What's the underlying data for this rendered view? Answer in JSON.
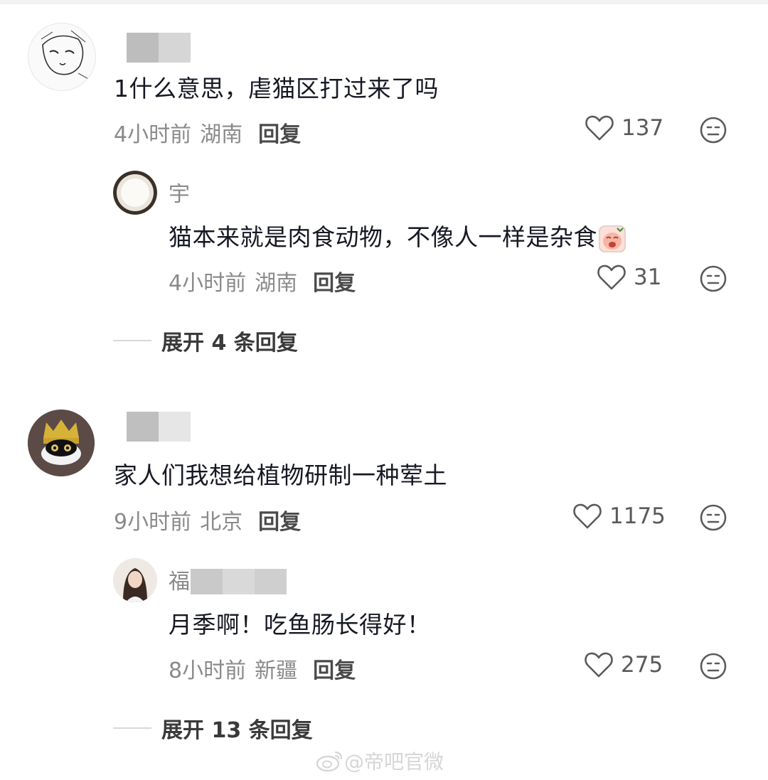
{
  "comments": [
    {
      "text": "1什么意思，虐猫区打过来了吗",
      "time": "4小时前",
      "location": "湖南",
      "reply_label": "回复",
      "likes": "137",
      "replies": [
        {
          "name": "宇",
          "text": "猫本来就是肉食动物，不像人一样是杂食",
          "time": "4小时前",
          "location": "湖南",
          "reply_label": "回复",
          "likes": "31"
        }
      ],
      "expand_label": "展开 4 条回复"
    },
    {
      "text": "家人们我想给植物研制一种荤土",
      "time": "9小时前",
      "location": "北京",
      "reply_label": "回复",
      "likes": "1175",
      "replies": [
        {
          "name": "福",
          "text": "月季啊！吃鱼肠长得好！",
          "time": "8小时前",
          "location": "新疆",
          "reply_label": "回复",
          "likes": "275"
        }
      ],
      "expand_label": "展开 13 条回复"
    }
  ],
  "watermark": "@帝吧官微",
  "icons": {
    "like": "heart-outline-icon",
    "dislike": "neutral-face-icon",
    "emoji": "crying-face-emoji"
  },
  "colors": {
    "primary_text": "#161823",
    "secondary_text": "#8a8a8a",
    "blur_placeholder": "#cfcfcf"
  }
}
